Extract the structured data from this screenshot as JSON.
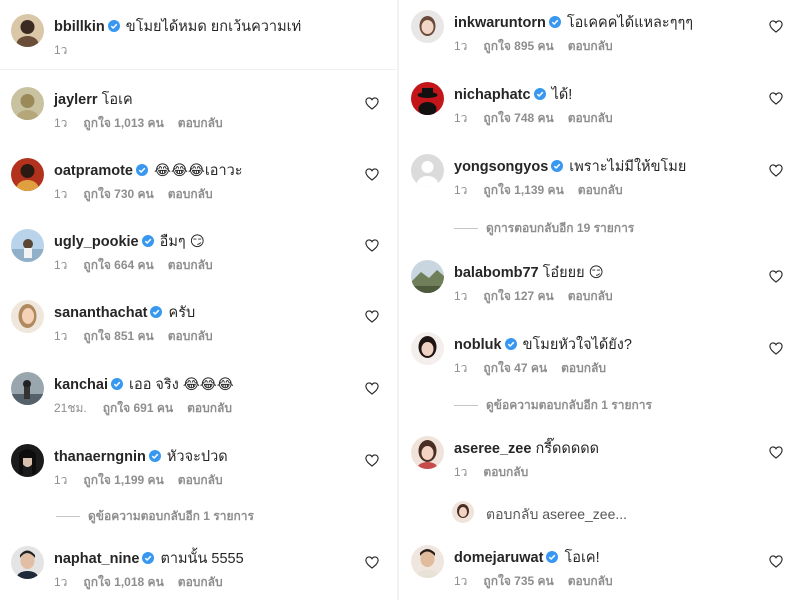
{
  "left_column": [
    {
      "username": "bbillkin",
      "verified": true,
      "text": "ขโมยได้หมด ยกเว้นความเท่",
      "time": "1ว",
      "likes": "",
      "reply": "",
      "heart": false
    },
    {
      "username": "jaylerr",
      "verified": false,
      "text": "โอเค",
      "time": "1ว",
      "likes": "ถูกใจ 1,013 คน",
      "reply": "ตอบกลับ",
      "heart": true
    },
    {
      "username": "oatpramote",
      "verified": true,
      "text": "😂😂😂เอาวะ",
      "time": "1ว",
      "likes": "ถูกใจ 730 คน",
      "reply": "ตอบกลับ",
      "heart": true
    },
    {
      "username": "ugly_pookie",
      "verified": true,
      "text": "อืมๆ 😏",
      "time": "1ว",
      "likes": "ถูกใจ 664 คน",
      "reply": "ตอบกลับ",
      "heart": true
    },
    {
      "username": "sananthachat",
      "verified": true,
      "text": "ครับ",
      "time": "1ว",
      "likes": "ถูกใจ 851 คน",
      "reply": "ตอบกลับ",
      "heart": true
    },
    {
      "username": "kanchai",
      "verified": true,
      "text": "เออ จริง 😂😂😂",
      "time": "21ชม.",
      "likes": "ถูกใจ 691 คน",
      "reply": "ตอบกลับ",
      "heart": true
    },
    {
      "username": "thanaerngnin",
      "verified": true,
      "text": "หัวจะปวด",
      "time": "1ว",
      "likes": "ถูกใจ 1,199 คน",
      "reply": "ตอบกลับ",
      "heart": true
    },
    {
      "username": "naphat_nine",
      "verified": true,
      "text": "ตามนั้น 5555",
      "time": "1ว",
      "likes": "ถูกใจ 1,018 คน",
      "reply": "ตอบกลับ",
      "heart": true
    }
  ],
  "left_view_replies": "ดูข้อความตอบกลับอีก 1 รายการ",
  "right_column": [
    {
      "username": "inkwaruntorn",
      "verified": true,
      "text": "โอเคคคได้แหละๆๆๆ",
      "time": "1ว",
      "likes": "ถูกใจ 895 คน",
      "reply": "ตอบกลับ",
      "heart": true
    },
    {
      "username": "nichaphatc",
      "verified": true,
      "text": "ได้!",
      "time": "1ว",
      "likes": "ถูกใจ 748 คน",
      "reply": "ตอบกลับ",
      "heart": true
    },
    {
      "username": "yongsongyos",
      "verified": true,
      "text": "เพราะไม่มีให้ขโมย",
      "time": "1ว",
      "likes": "ถูกใจ 1,139 คน",
      "reply": "ตอบกลับ",
      "heart": true
    },
    {
      "username": "balabomb77",
      "verified": false,
      "text": "โอ๋ยยย 😏",
      "time": "1ว",
      "likes": "ถูกใจ 127 คน",
      "reply": "ตอบกลับ",
      "heart": true
    },
    {
      "username": "nobluk",
      "verified": true,
      "text": "ขโมยหัวใจได้ยัง?",
      "time": "1ว",
      "likes": "ถูกใจ 47 คน",
      "reply": "ตอบกลับ",
      "heart": true
    },
    {
      "username": "aseree_zee",
      "verified": false,
      "text": "กรี๊ดดดดด",
      "time": "1ว",
      "likes": "",
      "reply": "ตอบกลับ",
      "heart": true
    },
    {
      "username": "domejaruwat",
      "verified": true,
      "text": "โอเค!",
      "time": "1ว",
      "likes": "ถูกใจ 735 คน",
      "reply": "ตอบกลับ",
      "heart": true
    }
  ],
  "right_view_replies_1": "ดูการตอบกลับอีก 19 รายการ",
  "right_view_replies_2": "ดูข้อความตอบกลับอีก 1 รายการ",
  "reply_draft": "ตอบกลับ aseree_zee...",
  "colors": {
    "verified": "#3897f0",
    "text": "#262626",
    "muted": "#8e8e8e"
  }
}
